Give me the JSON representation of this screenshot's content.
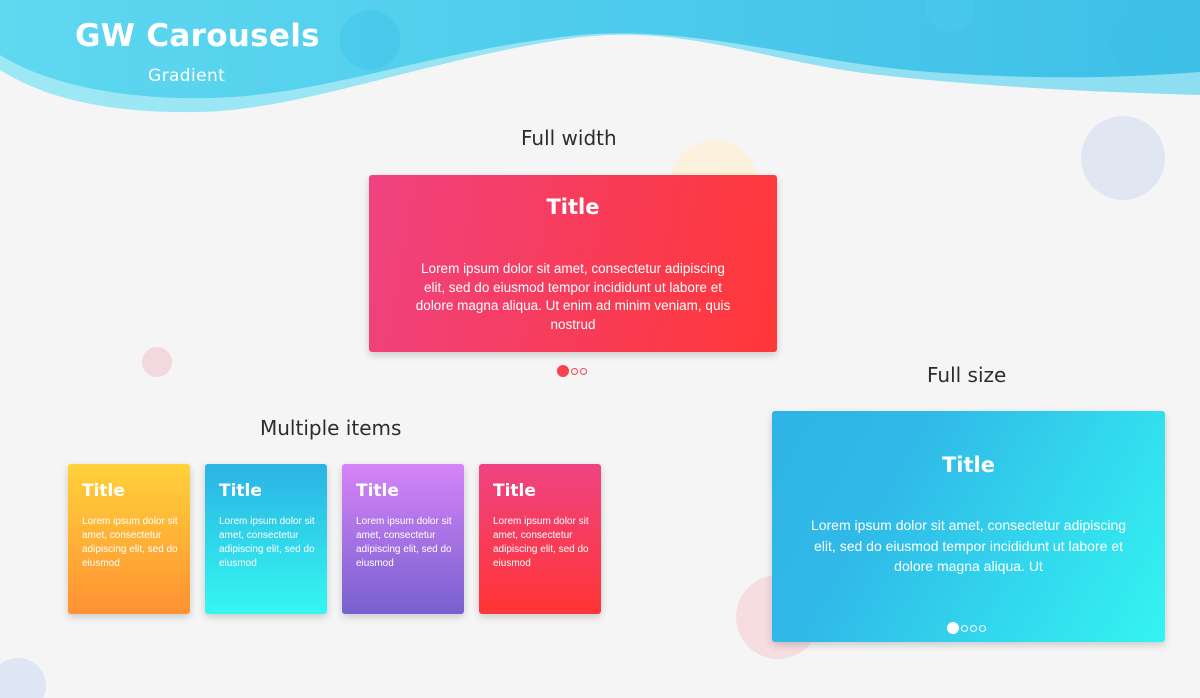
{
  "header": {
    "title": "GW Carousels",
    "subtitle": "Gradient"
  },
  "sections": {
    "full_width": {
      "heading": "Full width",
      "card_title": "Title",
      "card_text": "Lorem ipsum dolor sit amet, consectetur adipiscing elit, sed do eiusmod tempor incididunt ut labore et dolore magna aliqua. Ut enim ad minim veniam, quis nostrud",
      "gradient": [
        "#ef4280",
        "#ff3737"
      ],
      "pagination": {
        "count": 3,
        "active": 1
      }
    },
    "full_size": {
      "heading": "Full size",
      "card_title": "Title",
      "card_text": "Lorem ipsum dolor sit amet, consectetur adipiscing elit, sed do eiusmod tempor incididunt ut labore et dolore magna aliqua. Ut",
      "gradient": [
        "#2eb4e6",
        "#34f4f2"
      ],
      "pagination": {
        "count": 4,
        "active": 1
      }
    },
    "multiple_items": {
      "heading": "Multiple items",
      "items": [
        {
          "title": "Title",
          "text": "Lorem ipsum dolor sit amet, consectetur adipiscing elit, sed do eiusmod",
          "gradient": [
            "#ffd23a",
            "#ff9133"
          ]
        },
        {
          "title": "Title",
          "text": "Lorem ipsum dolor sit amet, consectetur adipiscing elit, sed do eiusmod",
          "gradient": [
            "#2bb3e4",
            "#35f7f1"
          ]
        },
        {
          "title": "Title",
          "text": "Lorem ipsum dolor sit amet, consectetur adipiscing elit, sed do eiusmod",
          "gradient": [
            "#d684f7",
            "#7760d0"
          ]
        },
        {
          "title": "Title",
          "text": "Lorem ipsum dolor sit amet, consectetur adipiscing elit, sed do eiusmod",
          "gradient": [
            "#ef4381",
            "#ff3535"
          ]
        }
      ]
    }
  },
  "colors": {
    "background": "#f5f5f6",
    "header_wave": "#3cc7ea",
    "pagination_active_red": "#f7434e"
  }
}
